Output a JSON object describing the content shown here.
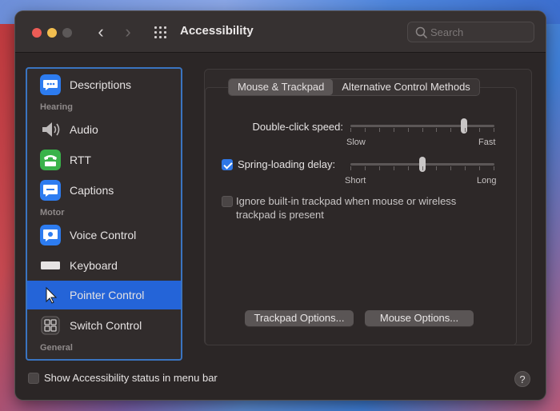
{
  "window": {
    "title": "Accessibility",
    "search": {
      "placeholder": "Search"
    }
  },
  "sidebar": {
    "items": [
      {
        "label": "Descriptions",
        "icon": "speech-bubble-icon"
      },
      {
        "label": "Audio",
        "icon": "speaker-icon"
      },
      {
        "label": "RTT",
        "icon": "tty-phone-icon"
      },
      {
        "label": "Captions",
        "icon": "captions-icon"
      },
      {
        "label": "Voice Control",
        "icon": "voice-control-icon"
      },
      {
        "label": "Keyboard",
        "icon": "keyboard-icon"
      },
      {
        "label": "Pointer Control",
        "icon": "pointer-icon",
        "selected": true
      },
      {
        "label": "Switch Control",
        "icon": "switch-control-icon"
      }
    ],
    "headers": [
      "Hearing",
      "Motor",
      "General"
    ]
  },
  "tabs": [
    {
      "label": "Mouse & Trackpad",
      "active": true
    },
    {
      "label": "Alternative Control Methods",
      "active": false
    }
  ],
  "double_click": {
    "label": "Double-click speed:",
    "min_label": "Slow",
    "max_label": "Fast",
    "value": 0.8
  },
  "spring_loading": {
    "label": "Spring-loading delay:",
    "checked": true,
    "min_label": "Short",
    "max_label": "Long",
    "value": 0.5
  },
  "ignore_trackpad": {
    "label_line1": "Ignore built-in trackpad when mouse or wireless",
    "label_line2": "trackpad is present",
    "checked": false
  },
  "buttons": {
    "trackpad_options": "Trackpad Options...",
    "mouse_options": "Mouse Options..."
  },
  "footer": {
    "status_label": "Show Accessibility status in menu bar",
    "status_checked": false,
    "help": "?"
  },
  "colors": {
    "accent": "#2464d8",
    "sidebar_border": "#3a74c0",
    "window_bg": "#2b2626"
  }
}
